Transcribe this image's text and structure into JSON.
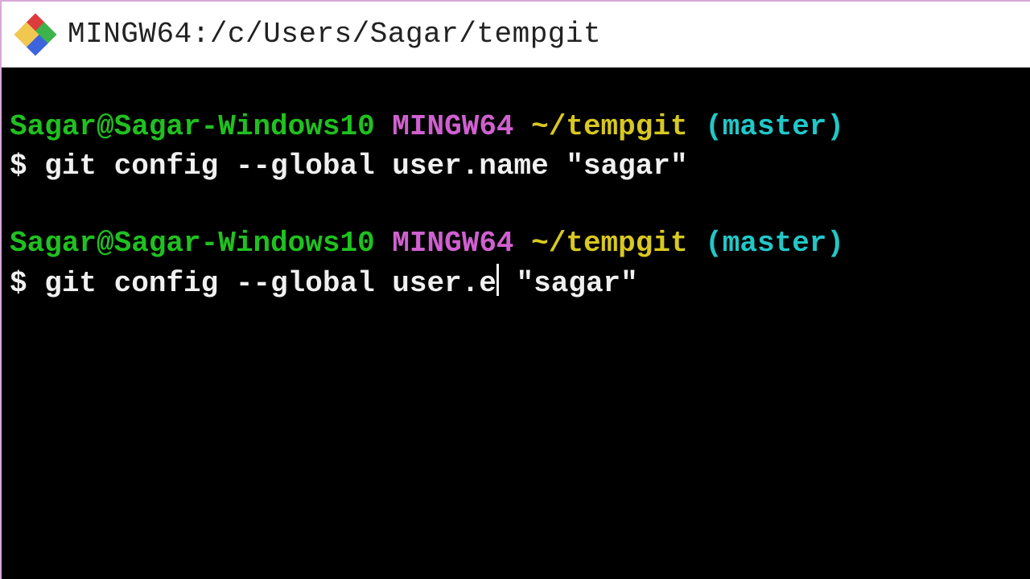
{
  "window": {
    "title": "MINGW64:/c/Users/Sagar/tempgit"
  },
  "prompt": {
    "user_host": "Sagar@Sagar-Windows10",
    "env": "MINGW64",
    "path": "~/tempgit",
    "branch": "(master)",
    "symbol": "$"
  },
  "history": [
    {
      "command": "git config --global user.name \"sagar\""
    }
  ],
  "current": {
    "before_cursor": "git config --global user.e",
    "after_cursor": " \"sagar\""
  }
}
